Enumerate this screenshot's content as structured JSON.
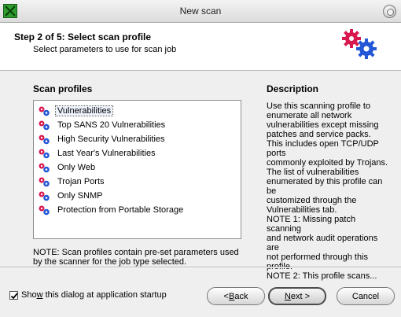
{
  "window": {
    "title": "New scan"
  },
  "header": {
    "step_title": "Step 2 of 5: Select scan profile",
    "step_subtitle": "Select parameters to use for scan job"
  },
  "profiles": {
    "heading": "Scan profiles",
    "items": [
      {
        "label": "Vulnerabilities",
        "selected": true
      },
      {
        "label": "Top SANS 20 Vulnerabilities"
      },
      {
        "label": "High Security Vulnerabilities"
      },
      {
        "label": "Last Year's Vulnerabilities"
      },
      {
        "label": "Only Web"
      },
      {
        "label": "Trojan Ports"
      },
      {
        "label": "Only SNMP"
      },
      {
        "label": "Protection from Portable Storage"
      }
    ],
    "note": "NOTE: Scan profiles contain pre-set parameters used by the scanner for the job type selected."
  },
  "description": {
    "heading": "Description",
    "text": "Use this scanning profile to\nenumerate all network\nvulnerabilities except missing\npatches and service packs.\nThis includes open TCP/UDP ports\ncommonly exploited by Trojans.\nThe list of vulnerabilities\nenumerated by this profile can be\ncustomized through the\nVulnerabilities tab.\nNOTE 1: Missing patch scanning\nand network audit operations are\nnot performed through this\nprofile.\nNOTE 2: This profile scans..."
  },
  "footer": {
    "startup_checkbox_prefix": "Sho",
    "startup_checkbox_mnemonic": "w",
    "startup_checkbox_suffix": " this dialog at application startup",
    "startup_checked": true,
    "back_prefix": "< ",
    "back_mnemonic": "B",
    "back_suffix": "ack",
    "next_mnemonic": "N",
    "next_suffix": "ext >",
    "cancel_label": "Cancel"
  },
  "colors": {
    "gear_red": "#d8194f",
    "gear_blue": "#2357d6"
  }
}
